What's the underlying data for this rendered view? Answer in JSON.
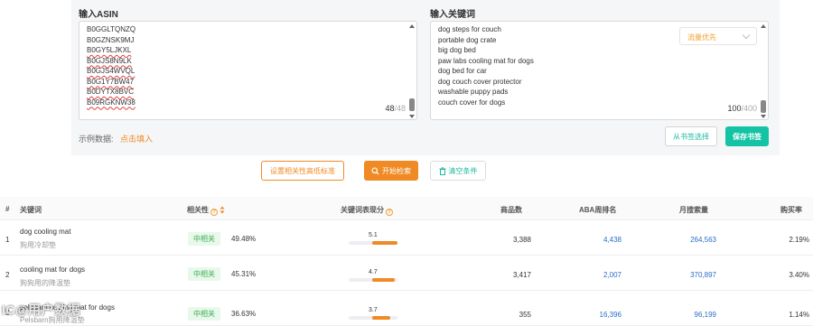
{
  "asin_section": {
    "title": "输入ASIN",
    "lines": [
      "B0GGLTQNZQ",
      "B0GZNSK9MJ",
      "B0GY5LJKXL",
      "B0GJS8N9LK",
      "B0GJS4WVQL",
      "B0G1Y7BW47",
      "B0DYTX8BVC",
      "B09RGKNW38"
    ],
    "count": "48",
    "max": "/48"
  },
  "keyword_section": {
    "title": "输入关键词",
    "lines": [
      "dog steps for couch",
      "portable dog crate",
      "big dog bed",
      "paw labs cooling mat for dogs",
      "dog bed for car",
      "dog couch cover protector",
      "washable puppy pads",
      "couch cover for dogs"
    ],
    "count": "100",
    "max": "/400",
    "sort_select": "流量优先"
  },
  "example": {
    "label": "示例数据:",
    "link": "点击填入"
  },
  "buttons": {
    "bookmark_select": "从书签选择",
    "bookmark_save": "保存书签",
    "relevance_standard": "设置相关性高低标准",
    "start_search": "开始检索",
    "clear": "清空条件"
  },
  "table": {
    "headers": {
      "index": "#",
      "keyword": "关键词",
      "relevance": "相关性",
      "score": "关键词表现分",
      "products": "商品数",
      "aba_rank": "ABA周排名",
      "monthly_search": "月搜索量",
      "purchase_rate": "购买率"
    },
    "rows": [
      {
        "index": "1",
        "keyword": "dog cooling mat",
        "keyword_cn": "狗用冷却垫",
        "relevance_tag": "中相关",
        "relevance_pct": "49.48%",
        "score": "5.1",
        "score_fraction": 0.51,
        "products": "3,388",
        "aba_rank": "4,438",
        "monthly_search": "264,563",
        "purchase_rate": "2.19%"
      },
      {
        "index": "2",
        "keyword": "cooling mat for dogs",
        "keyword_cn": "狗狗用的降温垫",
        "relevance_tag": "中相关",
        "relevance_pct": "45.31%",
        "score": "4.7",
        "score_fraction": 0.47,
        "products": "3,417",
        "aba_rank": "2,007",
        "monthly_search": "370,897",
        "purchase_rate": "3.40%"
      },
      {
        "index": "3",
        "keyword": "pelsbarn cooling mat for dogs",
        "keyword_cn": "Pelsbarn狗用降温垫",
        "relevance_tag": "中相关",
        "relevance_pct": "36.63%",
        "score": "3.7",
        "score_fraction": 0.37,
        "products": "355",
        "aba_rank": "16,396",
        "monthly_search": "96,199",
        "purchase_rate": "1.14%"
      }
    ]
  },
  "watermark": "IC@用户数据"
}
